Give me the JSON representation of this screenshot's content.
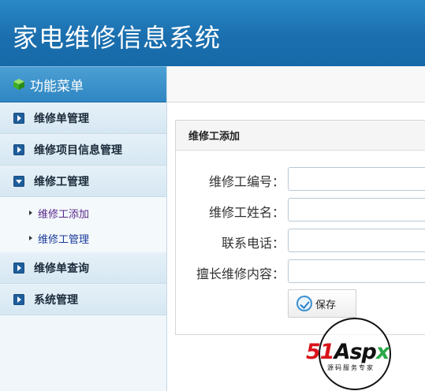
{
  "app": {
    "title": "家电维修信息系统"
  },
  "sidebar": {
    "header_label": "功能菜单",
    "items": [
      {
        "label": "维修单管理",
        "expanded": false
      },
      {
        "label": "维修项目信息管理",
        "expanded": false
      },
      {
        "label": "维修工管理",
        "expanded": true,
        "children": [
          {
            "label": "维修工添加",
            "visited": true
          },
          {
            "label": "维修工管理",
            "visited": false
          }
        ]
      },
      {
        "label": "维修单查询",
        "expanded": false
      },
      {
        "label": "系统管理",
        "expanded": false
      }
    ]
  },
  "panel": {
    "title": "维修工添加",
    "fields": [
      {
        "label": "维修工编号：",
        "value": ""
      },
      {
        "label": "维修工姓名：",
        "value": ""
      },
      {
        "label": "联系电话：",
        "value": ""
      },
      {
        "label": "擅长维修内容：",
        "value": ""
      }
    ],
    "save_label": "保存"
  },
  "watermark": {
    "brand_text": "51Aspx",
    "tagline": "源码服务专家"
  },
  "colors": {
    "header": "#1b6fae",
    "accent": "#1e5e9c",
    "link": "#1a3a99"
  }
}
